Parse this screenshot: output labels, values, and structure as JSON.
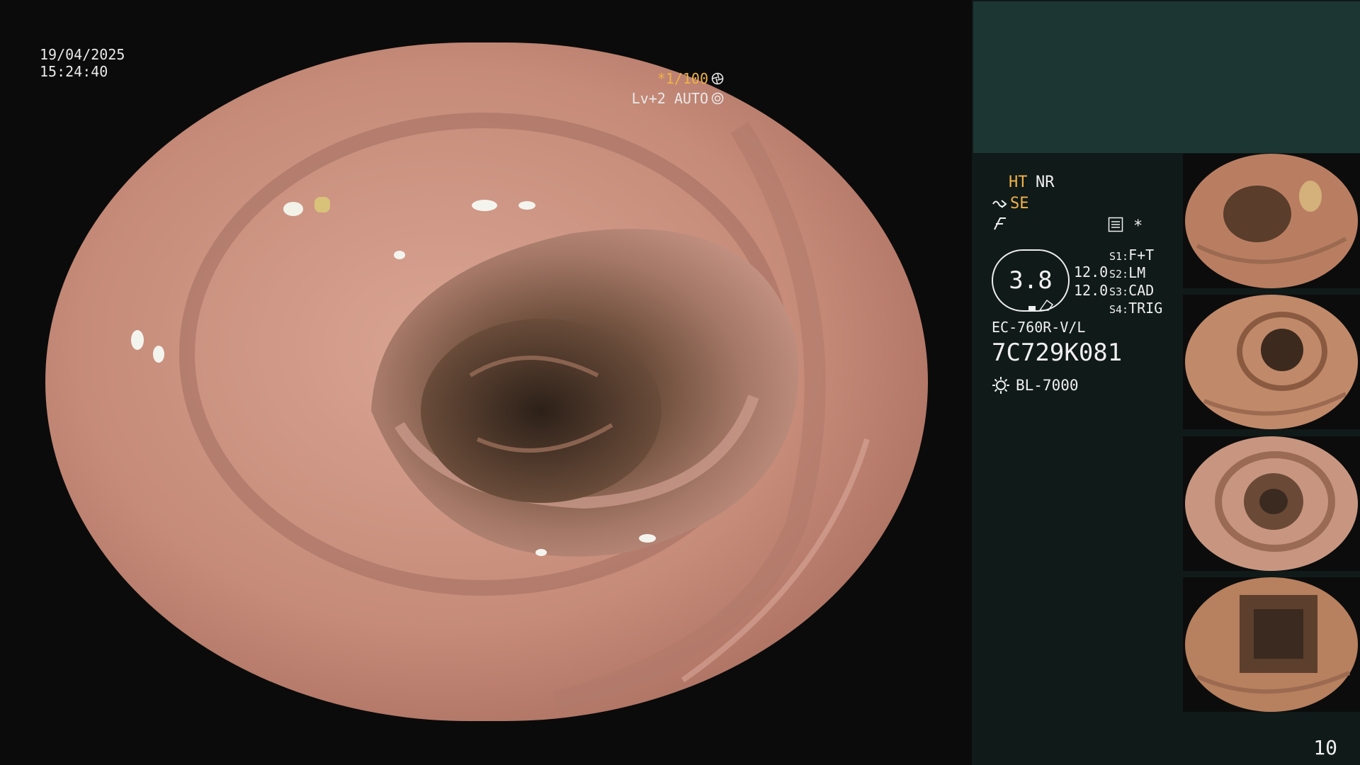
{
  "osd": {
    "date": "19/04/2025",
    "time": "15:24:40",
    "shutter": "*1/100",
    "level": "Lv+2 AUTO"
  },
  "panel": {
    "ht": "HT",
    "nr": "NR",
    "se": "SE",
    "asterisk": "*",
    "zoom": "3.8",
    "scale_top": "12.0",
    "scale_bottom": "12.0",
    "presets": [
      {
        "key": "S1:",
        "value": "F+T"
      },
      {
        "key": "S2:",
        "value": "LM"
      },
      {
        "key": "S3:",
        "value": "CAD"
      },
      {
        "key": "S4:",
        "value": "TRIG"
      }
    ],
    "scope_model": "EC-760R-V/L",
    "scope_serial": "7C729K081",
    "light_source": "BL-7000",
    "page_number": "10"
  },
  "thumbnails": [
    {
      "name": "captured-image-1"
    },
    {
      "name": "captured-image-2"
    },
    {
      "name": "captured-image-3"
    },
    {
      "name": "captured-image-4"
    }
  ],
  "colors": {
    "panel_bg": "#101a19",
    "panel_header": "#1c3733",
    "accent_orange": "#f2b24b",
    "tissue": "#c98e7d"
  }
}
